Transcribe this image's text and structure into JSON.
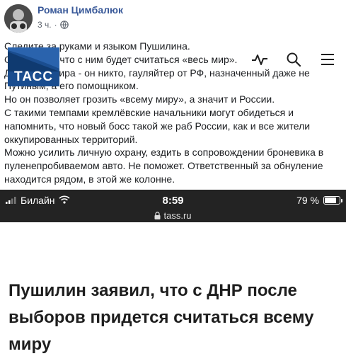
{
  "post": {
    "author": "Роман Цимбалюк",
    "time": "3 ч.",
    "separator": "·",
    "lines": [
      "Следите за руками и языком Пушилина.",
      "Он говорит, что с ним будет считаться «весь мир».",
      "Для всего мира - он никто, гауляйтер от РФ, назначенный даже не Путиным, а его помощником.",
      "Но он позволяет грозить «всему миру», а значит и России.",
      "С такими темпами кремлёвские начальники могут обидеться и напомнить, что новый босс такой же раб России, как и все жители оккупированных территорий.",
      "Можно усилить личную охрану, ездить в сопровождении броневика в пуленепробиваемом авто. Не поможет. Ответственный за обнуление находится рядом, в этой же колонне."
    ]
  },
  "phone": {
    "carrier": "Билайн",
    "time": "8:59",
    "battery": "79 %",
    "battery_level": 0.79,
    "url": "tass.ru"
  },
  "site": {
    "logo": "ТАСС",
    "headline": "Пушилин заявил, что с ДНР после выборов придется считаться всему миру"
  },
  "icons": {
    "globe": "globe-icon",
    "signal": "signal-icon",
    "wifi": "wifi-icon",
    "lock": "lock-icon",
    "pulse": "pulse-icon",
    "search": "search-icon",
    "menu": "menu-icon"
  },
  "colors": {
    "author": "#385898",
    "tass_blue": "#1a4d8f",
    "statusbar": "#232323"
  }
}
